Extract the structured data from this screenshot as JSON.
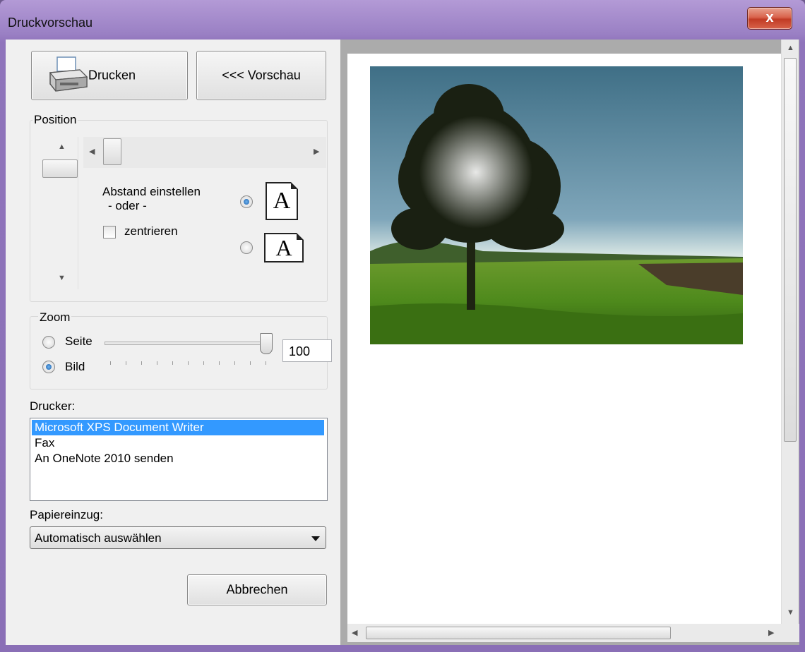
{
  "window": {
    "title": "Druckvorschau",
    "close_label": "x"
  },
  "toolbar": {
    "print_label": "Drucken",
    "preview_label": "<<< Vorschau"
  },
  "position": {
    "group_title": "Position",
    "set_distance_label": "Abstand einstellen",
    "or_label": "- oder -",
    "center_label": "zentrieren",
    "center_checked": false,
    "orientation_selected": "portrait",
    "page_glyph": "A"
  },
  "zoom": {
    "group_title": "Zoom",
    "page_label": "Seite",
    "image_label": "Bild",
    "selected": "Bild",
    "value": "100"
  },
  "printer": {
    "label": "Drucker:",
    "items": [
      "Microsoft XPS Document Writer",
      "Fax",
      "An OneNote 2010 senden"
    ],
    "selected_index": 0
  },
  "paper": {
    "label": "Papiereinzug:",
    "selected": "Automatisch auswählen"
  },
  "actions": {
    "cancel_label": "Abbrechen"
  },
  "colors": {
    "selection": "#3399ff",
    "title_bar": "#9a80c4",
    "close_button": "#c13b25"
  }
}
